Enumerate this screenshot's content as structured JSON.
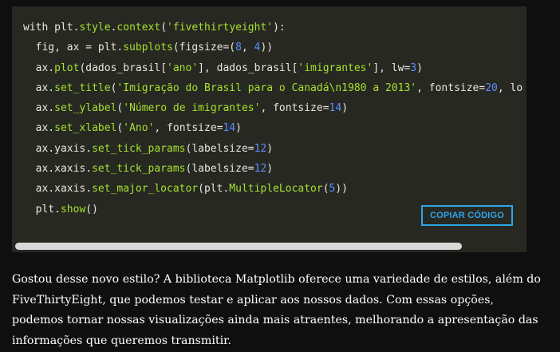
{
  "code": {
    "lines": [
      [
        {
          "t": "kw",
          "v": "with plt."
        },
        {
          "t": "fn",
          "v": "style"
        },
        {
          "t": "plain",
          "v": "."
        },
        {
          "t": "fn",
          "v": "context"
        },
        {
          "t": "plain",
          "v": "("
        },
        {
          "t": "str",
          "v": "'fivethirtyeight'"
        },
        {
          "t": "plain",
          "v": "):"
        }
      ],
      [
        {
          "t": "plain",
          "v": "  fig, ax = plt."
        },
        {
          "t": "fn",
          "v": "subplots"
        },
        {
          "t": "plain",
          "v": "(figsize=("
        },
        {
          "t": "num",
          "v": "8"
        },
        {
          "t": "plain",
          "v": ", "
        },
        {
          "t": "num",
          "v": "4"
        },
        {
          "t": "plain",
          "v": "))"
        }
      ],
      [
        {
          "t": "plain",
          "v": "  ax."
        },
        {
          "t": "fn",
          "v": "plot"
        },
        {
          "t": "plain",
          "v": "(dados_brasil["
        },
        {
          "t": "str",
          "v": "'ano'"
        },
        {
          "t": "plain",
          "v": "], dados_brasil["
        },
        {
          "t": "str",
          "v": "'imigrantes'"
        },
        {
          "t": "plain",
          "v": "], lw="
        },
        {
          "t": "num",
          "v": "3"
        },
        {
          "t": "plain",
          "v": ")"
        }
      ],
      [
        {
          "t": "plain",
          "v": "  ax."
        },
        {
          "t": "fn",
          "v": "set_title"
        },
        {
          "t": "plain",
          "v": "("
        },
        {
          "t": "str",
          "v": "'Imigração do Brasil para o Canadá\\n1980 a 2013'"
        },
        {
          "t": "plain",
          "v": ", fontsize="
        },
        {
          "t": "num",
          "v": "20"
        },
        {
          "t": "plain",
          "v": ", lo"
        }
      ],
      [
        {
          "t": "plain",
          "v": "  ax."
        },
        {
          "t": "fn",
          "v": "set_ylabel"
        },
        {
          "t": "plain",
          "v": "("
        },
        {
          "t": "str",
          "v": "'Número de imigrantes'"
        },
        {
          "t": "plain",
          "v": ", fontsize="
        },
        {
          "t": "num",
          "v": "14"
        },
        {
          "t": "plain",
          "v": ")"
        }
      ],
      [
        {
          "t": "plain",
          "v": "  ax."
        },
        {
          "t": "fn",
          "v": "set_xlabel"
        },
        {
          "t": "plain",
          "v": "("
        },
        {
          "t": "str",
          "v": "'Ano'"
        },
        {
          "t": "plain",
          "v": ", fontsize="
        },
        {
          "t": "num",
          "v": "14"
        },
        {
          "t": "plain",
          "v": ")"
        }
      ],
      [
        {
          "t": "plain",
          "v": "  ax.yaxis."
        },
        {
          "t": "fn",
          "v": "set_tick_params"
        },
        {
          "t": "plain",
          "v": "(labelsize="
        },
        {
          "t": "num",
          "v": "12"
        },
        {
          "t": "plain",
          "v": ")"
        }
      ],
      [
        {
          "t": "plain",
          "v": "  ax.xaxis."
        },
        {
          "t": "fn",
          "v": "set_tick_params"
        },
        {
          "t": "plain",
          "v": "(labelsize="
        },
        {
          "t": "num",
          "v": "12"
        },
        {
          "t": "plain",
          "v": ")"
        }
      ],
      [
        {
          "t": "plain",
          "v": "  ax.xaxis."
        },
        {
          "t": "fn",
          "v": "set_major_locator"
        },
        {
          "t": "plain",
          "v": "(plt."
        },
        {
          "t": "fn",
          "v": "MultipleLocator"
        },
        {
          "t": "plain",
          "v": "("
        },
        {
          "t": "num",
          "v": "5"
        },
        {
          "t": "plain",
          "v": "))"
        }
      ],
      [
        {
          "t": "plain",
          "v": "  plt."
        },
        {
          "t": "fn",
          "v": "show"
        },
        {
          "t": "plain",
          "v": "()"
        }
      ]
    ],
    "copy_label": "COPIAR CÓDIGO"
  },
  "article": {
    "paragraph": "Gostou desse novo estilo? A biblioteca Matplotlib oferece uma variedade de estilos, além do FiveThirtyEight, que podemos testar e aplicar aos nossos dados. Com essas opções, podemos tornar nossas visualizações ainda mais atraentes, melhorando a apresentação das informações que queremos transmitir."
  },
  "colors": {
    "page_background": "#0f0f0f",
    "code_background": "#272822",
    "accent": "#2fa6e8",
    "function_token": "#a6e22e",
    "number_token": "#5c8cff"
  }
}
